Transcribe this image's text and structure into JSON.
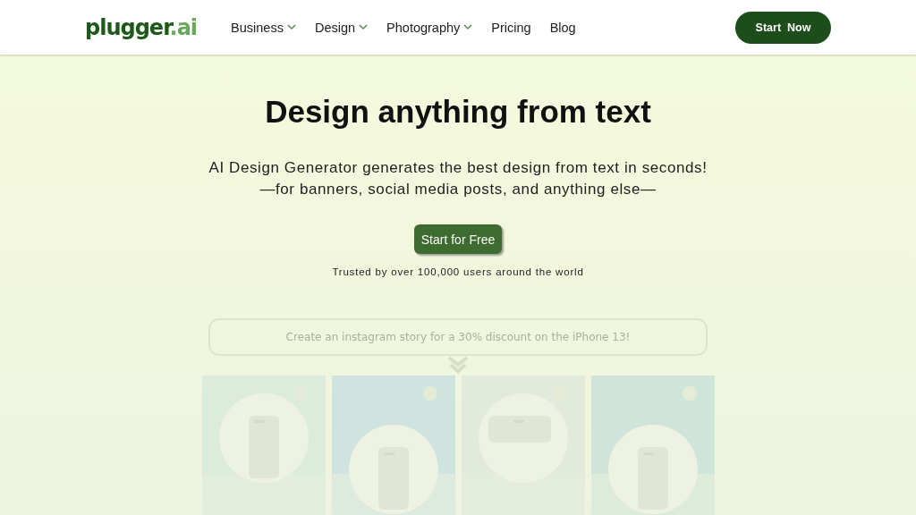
{
  "header": {
    "logo": {
      "name": "plugger",
      "suffix": ".ai"
    },
    "nav": [
      {
        "label": "Business",
        "dropdown": true
      },
      {
        "label": "Design",
        "dropdown": true
      },
      {
        "label": "Photography",
        "dropdown": true
      },
      {
        "label": "Pricing",
        "dropdown": false
      },
      {
        "label": "Blog",
        "dropdown": false
      }
    ],
    "cta": "Start  Now"
  },
  "hero": {
    "title": "Design anything from text",
    "subtitle_lines": [
      "AI Design Generator generates the best design from text in seconds!",
      "—for banners, social media posts, and anything else—"
    ],
    "button": "Start for Free",
    "trust": "Trusted by over 100,000 users around the world"
  },
  "demo": {
    "prompt": "Create an instagram story for a 30% discount on the iPhone 13!"
  }
}
